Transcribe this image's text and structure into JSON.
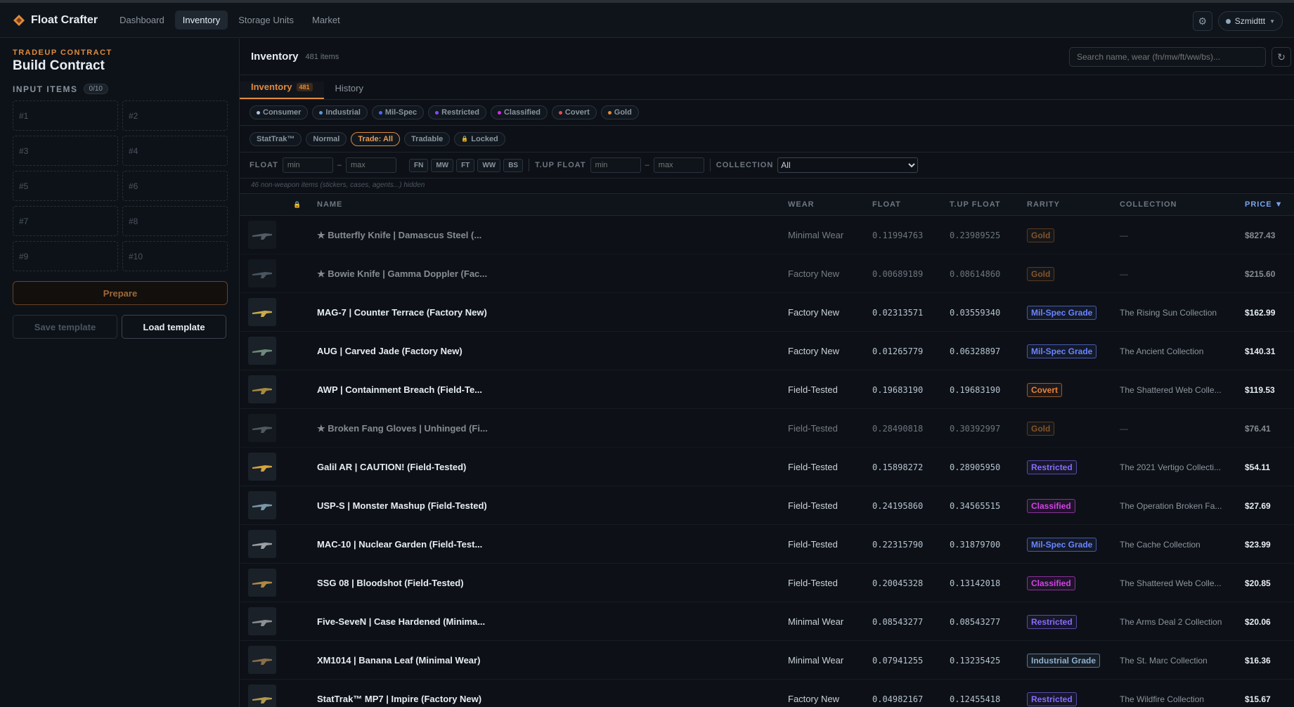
{
  "app": {
    "name": "Float Crafter"
  },
  "nav": [
    {
      "label": "Dashboard",
      "active": false
    },
    {
      "label": "Inventory",
      "active": true
    },
    {
      "label": "Storage Units",
      "active": false
    },
    {
      "label": "Market",
      "active": false
    }
  ],
  "user": {
    "name": "Szmidttt"
  },
  "sidebar": {
    "kicker": "TRADEUP CONTRACT",
    "title": "Build Contract",
    "input_label": "INPUT ITEMS",
    "input_count": "0/10",
    "slots": [
      "#1",
      "#2",
      "#3",
      "#4",
      "#5",
      "#6",
      "#7",
      "#8",
      "#9",
      "#10"
    ],
    "prepare_label": "Prepare",
    "save_template_label": "Save template",
    "load_template_label": "Load template"
  },
  "content": {
    "title": "Inventory",
    "count": "481 items",
    "search_placeholder": "Search name, wear (fn/mw/ft/ww/bs)...",
    "tabs": [
      {
        "label": "Inventory",
        "badge": "481",
        "active": true
      },
      {
        "label": "History",
        "badge": "",
        "active": false
      }
    ],
    "rarity_chips": [
      {
        "label": "Consumer",
        "color": "#b0c3d9"
      },
      {
        "label": "Industrial",
        "color": "#5e98d9"
      },
      {
        "label": "Mil-Spec",
        "color": "#4b69ff"
      },
      {
        "label": "Restricted",
        "color": "#8847ff"
      },
      {
        "label": "Classified",
        "color": "#d32ce6"
      },
      {
        "label": "Covert",
        "color": "#eb4b4b"
      },
      {
        "label": "Gold",
        "color": "#e08a3c"
      }
    ],
    "type_chips": [
      {
        "label": "StatTrak™",
        "on": false
      },
      {
        "label": "Normal",
        "on": false
      },
      {
        "label": "Trade: All",
        "on": true
      },
      {
        "label": "Tradable",
        "on": false
      },
      {
        "label": "Locked",
        "on": false
      }
    ],
    "float_label": "FLOAT",
    "min_placeholder": "min",
    "max_placeholder": "max",
    "wear_buttons": [
      "FN",
      "MW",
      "FT",
      "WW",
      "BS"
    ],
    "tup_float_label": "T.UP FLOAT",
    "collection_label": "COLLECTION",
    "collection_value": "All",
    "note": "46 non-weapon items (stickers, cases, agents...) hidden"
  },
  "table": {
    "headers": {
      "name": "NAME",
      "wear": "WEAR",
      "float": "FLOAT",
      "tup": "T.UP FLOAT",
      "rarity": "RARITY",
      "collection": "COLLECTION",
      "price": "PRICE ▼"
    },
    "rows": [
      {
        "name": "★ Butterfly Knife | Damascus Steel (...",
        "wear": "Minimal Wear",
        "float": "0.11994763",
        "tup": "0.23989525",
        "rarity": "Gold",
        "rarity_color": "#e08a3c",
        "collection": "—",
        "price": "$827.43",
        "dim": true,
        "tint": "#8a9aa8"
      },
      {
        "name": "★ Bowie Knife | Gamma Doppler (Fac...",
        "wear": "Factory New",
        "float": "0.00689189",
        "tup": "0.08614860",
        "rarity": "Gold",
        "rarity_color": "#e08a3c",
        "collection": "—",
        "price": "$215.60",
        "dim": true,
        "tint": "#7d8e9c"
      },
      {
        "name": "MAG-7 | Counter Terrace (Factory New)",
        "wear": "Factory New",
        "float": "0.02313571",
        "tup": "0.03559340",
        "rarity": "Mil-Spec Grade",
        "rarity_color": "#6a85ff",
        "collection": "The Rising Sun Collection",
        "price": "$162.99",
        "dim": false,
        "tint": "#c9a94a"
      },
      {
        "name": "AUG | Carved Jade (Factory New)",
        "wear": "Factory New",
        "float": "0.01265779",
        "tup": "0.06328897",
        "rarity": "Mil-Spec Grade",
        "rarity_color": "#6a85ff",
        "collection": "The Ancient Collection",
        "price": "$140.31",
        "dim": false,
        "tint": "#6f8a78"
      },
      {
        "name": "AWP | Containment Breach (Field-Te...",
        "wear": "Field-Tested",
        "float": "0.19683190",
        "tup": "0.19683190",
        "rarity": "Covert",
        "rarity_color": "#e8833a",
        "collection": "The Shattered Web Colle...",
        "price": "$119.53",
        "dim": false,
        "tint": "#a88b3f"
      },
      {
        "name": "★ Broken Fang Gloves | Unhinged (Fi...",
        "wear": "Field-Tested",
        "float": "0.28490818",
        "tup": "0.30392997",
        "rarity": "Gold",
        "rarity_color": "#e08a3c",
        "collection": "—",
        "price": "$76.41",
        "dim": true,
        "tint": "#8a949c"
      },
      {
        "name": "Galil AR | CAUTION! (Field-Tested)",
        "wear": "Field-Tested",
        "float": "0.15898272",
        "tup": "0.28905950",
        "rarity": "Restricted",
        "rarity_color": "#8a6cff",
        "collection": "The 2021 Vertigo Collecti...",
        "price": "$54.11",
        "dim": false,
        "tint": "#d6a23a"
      },
      {
        "name": "USP-S | Monster Mashup (Field-Tested)",
        "wear": "Field-Tested",
        "float": "0.24195860",
        "tup": "0.34565515",
        "rarity": "Classified",
        "rarity_color": "#d542e8",
        "collection": "The Operation Broken Fa...",
        "price": "$27.69",
        "dim": false,
        "tint": "#7a98a8"
      },
      {
        "name": "MAC-10 | Nuclear Garden (Field-Test...",
        "wear": "Field-Tested",
        "float": "0.22315790",
        "tup": "0.31879700",
        "rarity": "Mil-Spec Grade",
        "rarity_color": "#6a85ff",
        "collection": "The Cache Collection",
        "price": "$23.99",
        "dim": false,
        "tint": "#9aa0a4"
      },
      {
        "name": "SSG 08 | Bloodshot (Field-Tested)",
        "wear": "Field-Tested",
        "float": "0.20045328",
        "tup": "0.13142018",
        "rarity": "Classified",
        "rarity_color": "#d542e8",
        "collection": "The Shattered Web Colle...",
        "price": "$20.85",
        "dim": false,
        "tint": "#b08844"
      },
      {
        "name": "Five-SeveN | Case Hardened (Minima...",
        "wear": "Minimal Wear",
        "float": "0.08543277",
        "tup": "0.08543277",
        "rarity": "Restricted",
        "rarity_color": "#8a6cff",
        "collection": "The Arms Deal 2 Collection",
        "price": "$20.06",
        "dim": false,
        "tint": "#8c9094"
      },
      {
        "name": "XM1014 | Banana Leaf (Minimal Wear)",
        "wear": "Minimal Wear",
        "float": "0.07941255",
        "tup": "0.13235425",
        "rarity": "Industrial Grade",
        "rarity_color": "#8fb0d0",
        "collection": "The St. Marc Collection",
        "price": "$16.36",
        "dim": false,
        "tint": "#8a6e4a"
      },
      {
        "name": "StatTrak™ MP7 | Impire (Factory New)",
        "wear": "Factory New",
        "float": "0.04982167",
        "tup": "0.12455418",
        "rarity": "Restricted",
        "rarity_color": "#8a6cff",
        "collection": "The Wildfire Collection",
        "price": "$15.67",
        "dim": false,
        "tint": "#b09a4a"
      }
    ]
  }
}
